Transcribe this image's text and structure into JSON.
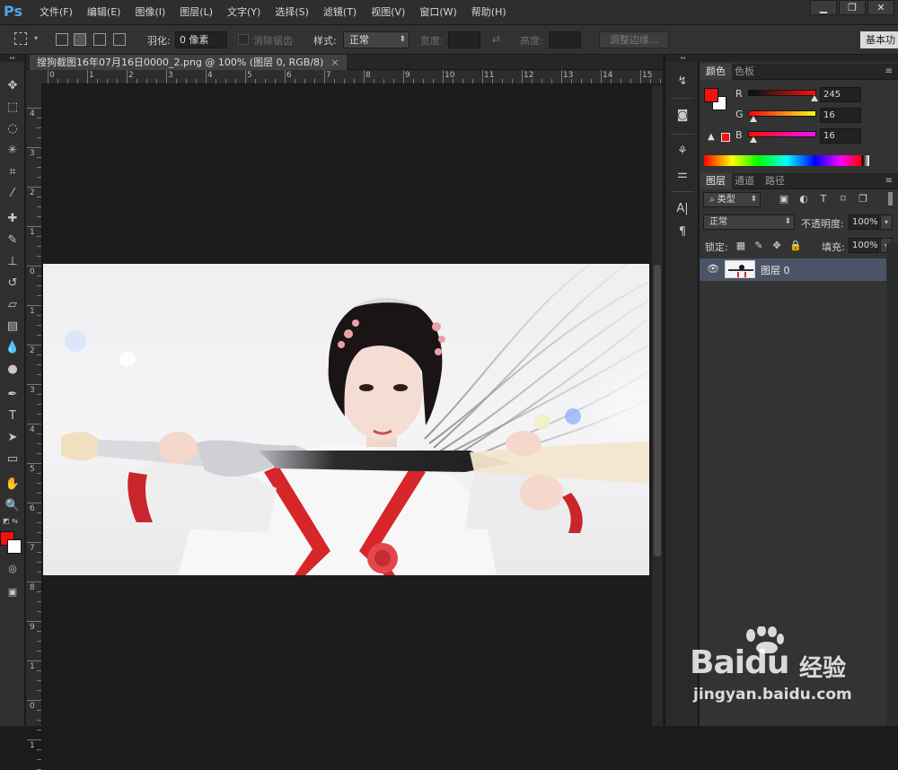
{
  "app": {
    "logo": "Ps"
  },
  "menus": [
    "文件(F)",
    "编辑(E)",
    "图像(I)",
    "图层(L)",
    "文字(Y)",
    "选择(S)",
    "滤镜(T)",
    "视图(V)",
    "窗口(W)",
    "帮助(H)"
  ],
  "window_controls": {
    "minimize": "▁",
    "restore": "❐",
    "close": "✕"
  },
  "options": {
    "feather_label": "羽化:",
    "feather_value": "0 像素",
    "antialias_label": "消除锯齿",
    "style_label": "样式:",
    "style_value": "正常",
    "width_label": "宽度:",
    "height_label": "高度:",
    "refine_button": "调整边缘...",
    "workspace_button": "基本功"
  },
  "document": {
    "tab_title": "搜狗截图16年07月16日0000_2.png @ 100% (图层 0, RGB/8)",
    "tab_close": "×"
  },
  "rulers": {
    "top": [
      "0",
      "1",
      "2",
      "3",
      "4",
      "5",
      "6",
      "7",
      "8",
      "9",
      "10",
      "11",
      "12",
      "13",
      "14",
      "15"
    ],
    "left": [
      "4",
      "3",
      "2",
      "1",
      "0",
      "1",
      "2",
      "3",
      "4",
      "5",
      "6",
      "7",
      "8",
      "9",
      "1",
      "0",
      "1"
    ]
  },
  "color_panel": {
    "tabs": [
      "颜色",
      "色板"
    ],
    "channels": [
      {
        "label": "R",
        "value": "245",
        "level": 0.96,
        "gradient": "linear-gradient(90deg,#001010,#ff1010)"
      },
      {
        "label": "G",
        "value": "16",
        "level": 0.06,
        "gradient": "linear-gradient(90deg,#f50010,#f5ff10)"
      },
      {
        "label": "B",
        "value": "16",
        "level": 0.06,
        "gradient": "linear-gradient(90deg,#f51000,#f510ff)"
      }
    ],
    "foreground": "#f51010",
    "background": "#ffffff"
  },
  "layers_panel": {
    "tabs": [
      "图层",
      "通道",
      "路径"
    ],
    "filter_kind": "类型",
    "blend_mode": "正常",
    "opacity_label": "不透明度:",
    "opacity_value": "100%",
    "lock_label": "锁定:",
    "fill_label": "填充:",
    "fill_value": "100%",
    "layers": [
      {
        "name": "图层 0",
        "visible_icon": "👁"
      }
    ]
  },
  "watermark": {
    "brand": "Bai",
    "brand2": "du",
    "cn": "经验",
    "url": "jingyan.baidu.com"
  }
}
